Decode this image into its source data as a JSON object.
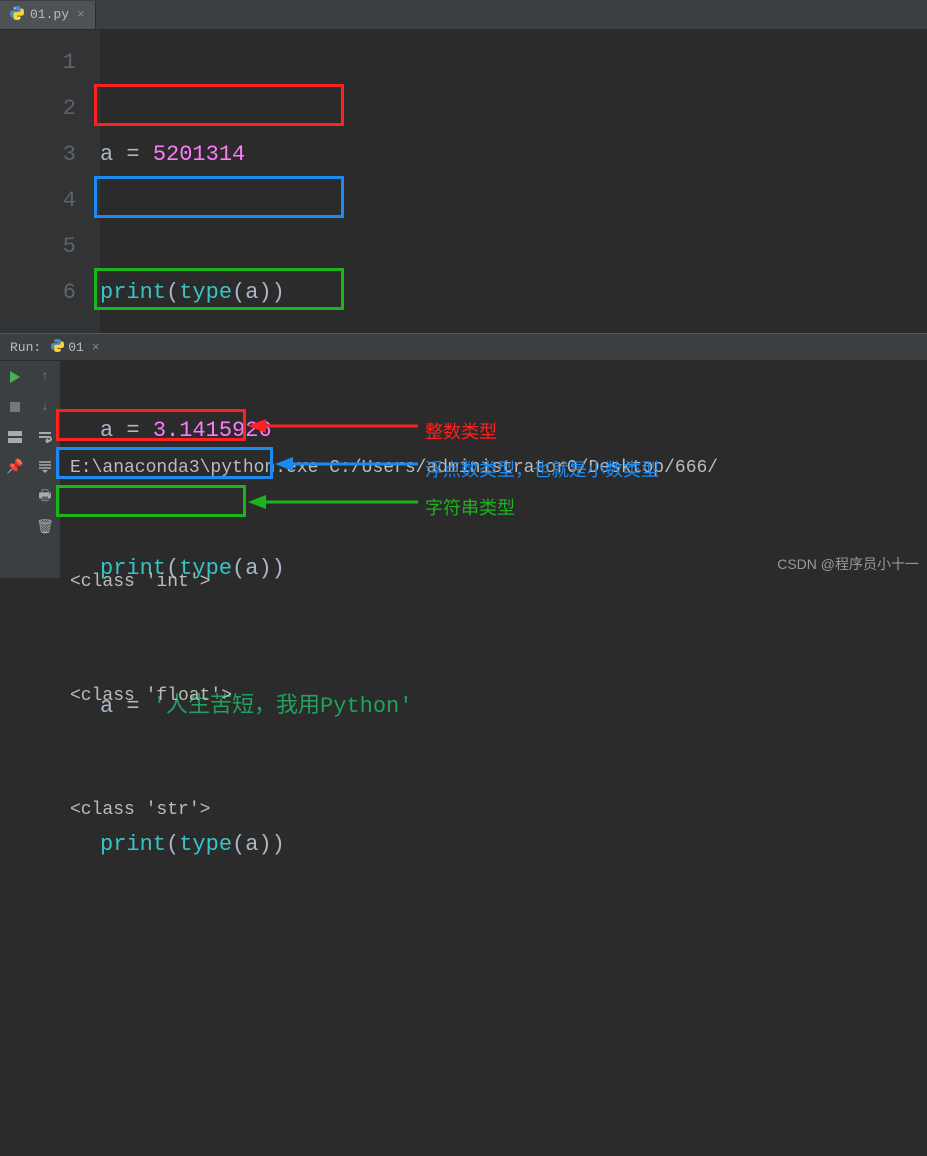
{
  "tab": {
    "filename": "01.py"
  },
  "gutter": [
    "1",
    "2",
    "3",
    "4",
    "5",
    "6"
  ],
  "code": {
    "line1": {
      "var": "a",
      "op": "=",
      "num": "5201314"
    },
    "line2": {
      "func": "print",
      "builtin": "type",
      "arg": "a"
    },
    "line3": {
      "var": "a",
      "op": "=",
      "num": "3.1415926"
    },
    "line4": {
      "func": "print",
      "builtin": "type",
      "arg": "a"
    },
    "line5": {
      "var": "a",
      "op": "=",
      "str": "'人生苦短，我用Python'"
    },
    "line6": {
      "func": "print",
      "builtin": "type",
      "arg": "a"
    }
  },
  "run": {
    "label": "Run:",
    "name": "01",
    "cmd": "E:\\anaconda3\\python.exe C:/Users/administrator0/Desktop/666/",
    "out1": "<class 'int'>",
    "out2": "<class 'float'>",
    "out3": "<class 'str'>"
  },
  "annotations": {
    "a1": "整数类型",
    "a2": "浮点数类型，也就是小数类型",
    "a3": "字符串类型"
  },
  "watermark": "CSDN @程序员小十一"
}
